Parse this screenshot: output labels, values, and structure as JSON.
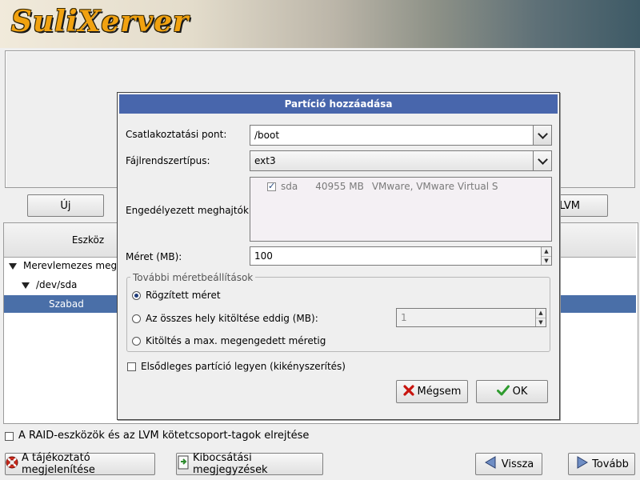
{
  "app": {
    "logo_text": "SuliXerver"
  },
  "left_buttons": {
    "new_label": "Új",
    "lvm_label": "LVM"
  },
  "tree": {
    "col_device": "Eszköz",
    "rows": [
      {
        "label": "Merevlemezes megh",
        "level": 0,
        "expanded": true,
        "selected": false
      },
      {
        "label": "/dev/sda",
        "level": 1,
        "expanded": true,
        "selected": false
      },
      {
        "label": "Szabad",
        "level": 2,
        "expanded": false,
        "selected": true
      }
    ]
  },
  "hide_raid": {
    "label": "A RAID-eszközök és az LVM kötetcsoport-tagok elrejtése",
    "checked": false
  },
  "footer": {
    "info_label": "A tájékoztató megjelenítése",
    "release_notes_label": "Kibocsátási megjegyzések",
    "back_label": "Vissza",
    "next_label": "Tovább"
  },
  "dialog": {
    "title": "Partíció hozzáadása",
    "mount_label": "Csatlakoztatási pont:",
    "mount_value": "/boot",
    "fstype_label": "Fájlrendszertípus:",
    "fstype_value": "ext3",
    "drives_label": "Engedélyezett meghajtók:",
    "drives": [
      {
        "checked": true,
        "name": "sda",
        "size": "40955 MB",
        "model": "VMware, VMware Virtual S"
      }
    ],
    "size_label": "Méret (MB):",
    "size_value": "100",
    "size_options_legend": "További méretbeállítások",
    "opt_fixed": "Rögzített méret",
    "opt_fill_upto": "Az összes hely kitöltése eddig (MB):",
    "fill_upto_value": "1",
    "opt_fill_max": "Kitöltés a max. megengedett méretig",
    "selected_size_option": "fixed",
    "primary_label": "Elsődleges partíció legyen (kikényszerítés)",
    "primary_checked": false,
    "cancel_label": "Mégsem",
    "ok_label": "OK"
  },
  "colors": {
    "title_bar": "#4866ac",
    "selection": "#4a6fa8",
    "logo": "#f1a210"
  },
  "icons": {
    "info": "lifebuoy-icon",
    "release_notes": "document-arrow-icon",
    "back": "arrow-left-icon",
    "next": "arrow-right-icon",
    "cancel": "red-x-icon",
    "ok": "green-check-icon"
  }
}
